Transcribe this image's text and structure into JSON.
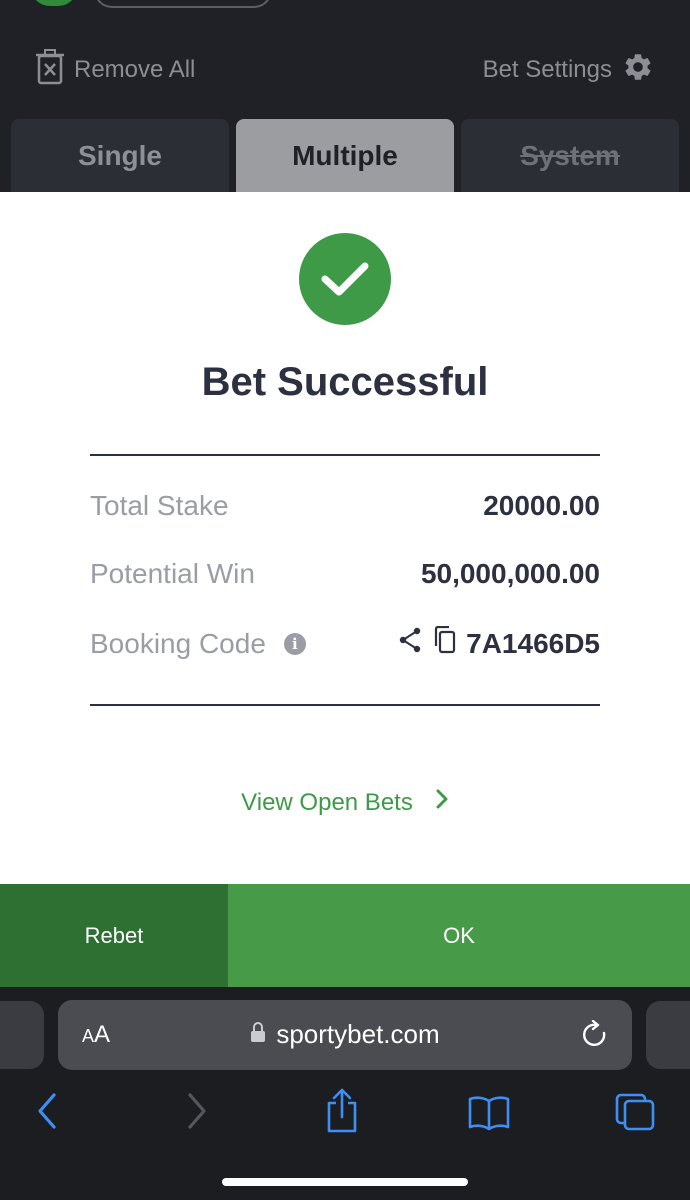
{
  "header": {
    "remove_all": "Remove All",
    "bet_settings": "Bet Settings"
  },
  "tabs": [
    {
      "label": "Single",
      "state": "normal"
    },
    {
      "label": "Multiple",
      "state": "active"
    },
    {
      "label": "System",
      "state": "disabled"
    }
  ],
  "modal": {
    "title": "Bet Successful",
    "total_stake_label": "Total Stake",
    "total_stake_value": "20000.00",
    "potential_win_label": "Potential Win",
    "potential_win_value": "50,000,000.00",
    "booking_code_label": "Booking Code",
    "booking_code_value": "7A1466D5",
    "view_open_bets": "View Open Bets"
  },
  "buttons": {
    "rebet": "Rebet",
    "ok": "OK"
  },
  "browser": {
    "text_size": "AA",
    "url": "sportybet.com"
  },
  "colors": {
    "accent_green": "#3f9a47",
    "ok_green": "#479a47",
    "rebet_green": "#2e6f32",
    "dark_bg": "#1f2126"
  },
  "icons": [
    "trash-icon",
    "gear-icon",
    "checkmark-icon",
    "info-icon",
    "share-icon",
    "copy-icon",
    "chevron-right-icon",
    "lock-icon",
    "reload-icon",
    "back-icon",
    "forward-icon",
    "share-box-icon",
    "bookmarks-icon",
    "tabs-icon"
  ]
}
